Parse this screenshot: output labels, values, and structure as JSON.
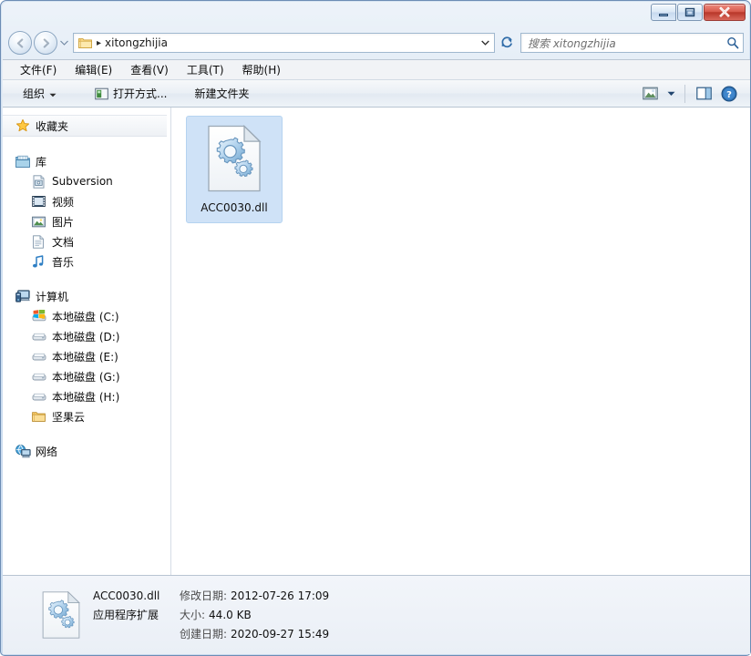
{
  "window": {
    "titlebar_buttons": [
      {
        "name": "minimize",
        "label": "–"
      },
      {
        "name": "maximize",
        "label": "□"
      },
      {
        "name": "close",
        "label": "✕"
      }
    ]
  },
  "address_bar": {
    "back_tooltip": "后退",
    "forward_tooltip": "前进",
    "folder_icon": "folder-icon",
    "separator": "▸",
    "path": "xitongzhijia",
    "dropdown_icon": "chevron-down-icon",
    "refresh_icon": "refresh-icon"
  },
  "search": {
    "placeholder": "搜索 xitongzhijia",
    "icon": "search-icon"
  },
  "menu": {
    "items": [
      {
        "name": "file",
        "label": "文件(F)"
      },
      {
        "name": "edit",
        "label": "编辑(E)"
      },
      {
        "name": "view",
        "label": "查看(V)"
      },
      {
        "name": "tools",
        "label": "工具(T)"
      },
      {
        "name": "help",
        "label": "帮助(H)"
      }
    ]
  },
  "toolbar": {
    "organize_label": "组织",
    "organize_caret": "▾",
    "open_with_label": "打开方式...",
    "new_folder_label": "新建文件夹",
    "change_view_icon": "change-view-icon",
    "change_view_caret": "▾",
    "preview_pane_icon": "preview-pane-icon",
    "help_icon": "help-icon"
  },
  "nav_pane": {
    "favorites": {
      "label": "收藏夹",
      "icon": "star-icon"
    },
    "libraries": {
      "label": "库",
      "icon": "library-icon",
      "children": [
        {
          "label": "Subversion",
          "icon": "subversion-icon"
        },
        {
          "label": "视频",
          "icon": "video-icon"
        },
        {
          "label": "图片",
          "icon": "pictures-icon"
        },
        {
          "label": "文档",
          "icon": "documents-icon"
        },
        {
          "label": "音乐",
          "icon": "music-icon"
        }
      ]
    },
    "computer": {
      "label": "计算机",
      "icon": "computer-icon",
      "children": [
        {
          "label": "本地磁盘 (C:)",
          "icon": "system-drive-icon"
        },
        {
          "label": "本地磁盘 (D:)",
          "icon": "drive-icon"
        },
        {
          "label": "本地磁盘 (E:)",
          "icon": "drive-icon"
        },
        {
          "label": "本地磁盘 (G:)",
          "icon": "drive-icon"
        },
        {
          "label": "本地磁盘 (H:)",
          "icon": "drive-icon"
        },
        {
          "label": "坚果云",
          "icon": "folder-icon"
        }
      ]
    },
    "network": {
      "label": "网络",
      "icon": "network-icon"
    }
  },
  "file_list": {
    "items": [
      {
        "name": "ACC0030.dll",
        "icon": "dll-file-icon",
        "selected": true
      }
    ]
  },
  "details_pane": {
    "icon": "dll-file-icon",
    "file_name": "ACC0030.dll",
    "file_type": "应用程序扩展",
    "modified_label": "修改日期:",
    "modified_value": "2012-07-26 17:09",
    "size_label": "大小:",
    "size_value": "44.0 KB",
    "created_label": "创建日期:",
    "created_value": "2020-09-27 15:49"
  },
  "colors": {
    "selection_blue": "#cfe2f7",
    "title_glass": "#cfdff0",
    "close_red": "#b8372a"
  }
}
